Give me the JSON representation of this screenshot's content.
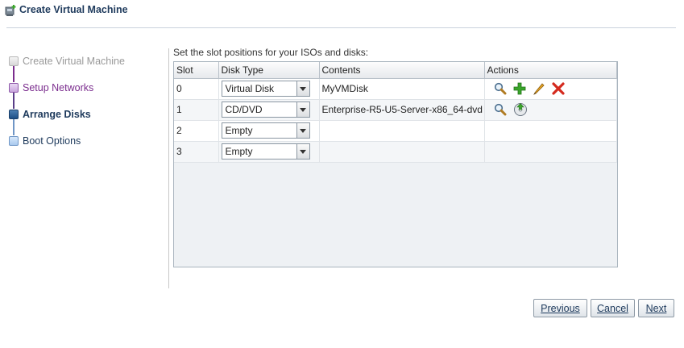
{
  "window": {
    "title": "Create Virtual Machine",
    "icon": "computer-icon"
  },
  "steps": [
    {
      "label": "Create Virtual Machine",
      "state": "completed"
    },
    {
      "label": "Setup Networks",
      "state": "visited"
    },
    {
      "label": "Arrange Disks",
      "state": "current"
    },
    {
      "label": "Boot Options",
      "state": "upcoming"
    }
  ],
  "main": {
    "instruction": "Set the slot positions for your ISOs and disks:",
    "columns": [
      "Slot",
      "Disk Type",
      "Contents",
      "Actions"
    ],
    "rows": [
      {
        "slot": "0",
        "disk_type": "Virtual Disk",
        "contents": "MyVMDisk",
        "actions": [
          "search-icon",
          "add-icon",
          "edit-icon",
          "delete-icon"
        ]
      },
      {
        "slot": "1",
        "disk_type": "CD/DVD",
        "contents": "Enterprise-R5-U5-Server-x86_64-dvd",
        "actions": [
          "search-icon",
          "eject-icon"
        ]
      },
      {
        "slot": "2",
        "disk_type": "Empty",
        "contents": "",
        "actions": []
      },
      {
        "slot": "3",
        "disk_type": "Empty",
        "contents": "",
        "actions": []
      }
    ]
  },
  "buttons": {
    "previous": "Previous",
    "cancel": "Cancel",
    "next": "Next"
  },
  "colors": {
    "accent": "#1e3a5c",
    "visited": "#7b2d8e",
    "delete": "#d42a1e",
    "add": "#3aa52b"
  }
}
